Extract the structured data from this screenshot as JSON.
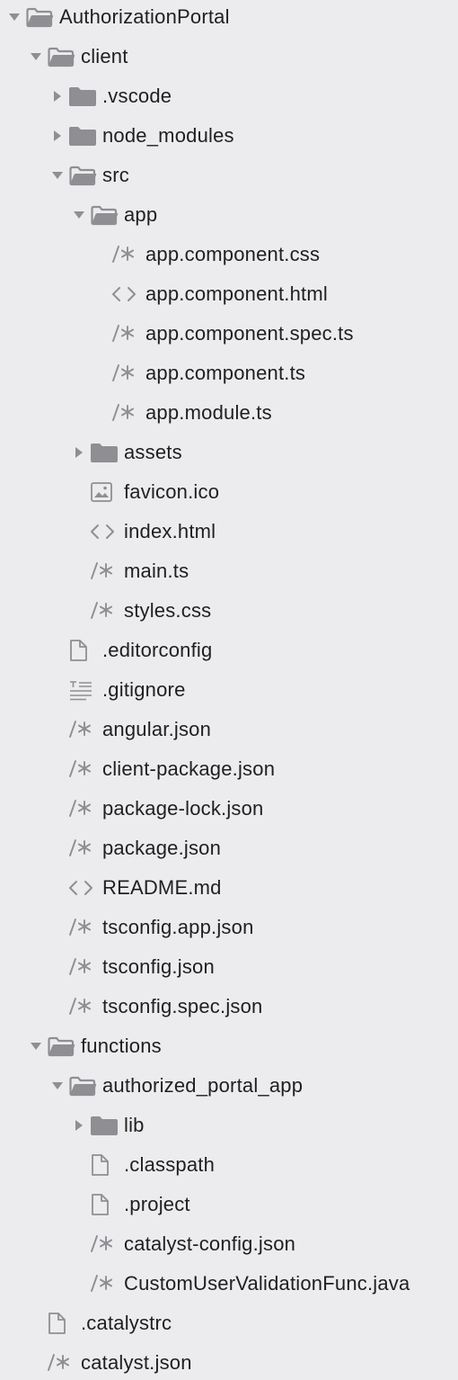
{
  "tree": [
    {
      "label": "AuthorizationPortal",
      "level": 0,
      "type": "folder",
      "state": "expanded",
      "icon": "folder-open-icon"
    },
    {
      "label": "client",
      "level": 1,
      "type": "folder",
      "state": "expanded",
      "icon": "folder-open-icon"
    },
    {
      "label": ".vscode",
      "level": 2,
      "type": "folder",
      "state": "collapsed",
      "icon": "folder-icon"
    },
    {
      "label": "node_modules",
      "level": 2,
      "type": "folder",
      "state": "collapsed",
      "icon": "folder-icon"
    },
    {
      "label": "src",
      "level": 2,
      "type": "folder",
      "state": "expanded",
      "icon": "folder-open-icon"
    },
    {
      "label": "app",
      "level": 3,
      "type": "folder",
      "state": "expanded",
      "icon": "folder-open-icon"
    },
    {
      "label": "app.component.css",
      "level": 4,
      "type": "file",
      "icon": "comment-code-icon"
    },
    {
      "label": "app.component.html",
      "level": 4,
      "type": "file",
      "icon": "angle-brackets-icon"
    },
    {
      "label": "app.component.spec.ts",
      "level": 4,
      "type": "file",
      "icon": "comment-code-icon"
    },
    {
      "label": "app.component.ts",
      "level": 4,
      "type": "file",
      "icon": "comment-code-icon"
    },
    {
      "label": "app.module.ts",
      "level": 4,
      "type": "file",
      "icon": "comment-code-icon"
    },
    {
      "label": "assets",
      "level": 3,
      "type": "folder",
      "state": "collapsed",
      "icon": "folder-icon"
    },
    {
      "label": "favicon.ico",
      "level": 3,
      "type": "file",
      "icon": "image-icon"
    },
    {
      "label": "index.html",
      "level": 3,
      "type": "file",
      "icon": "angle-brackets-icon"
    },
    {
      "label": "main.ts",
      "level": 3,
      "type": "file",
      "icon": "comment-code-icon"
    },
    {
      "label": "styles.css",
      "level": 3,
      "type": "file",
      "icon": "comment-code-icon"
    },
    {
      "label": ".editorconfig",
      "level": 2,
      "type": "file",
      "icon": "document-icon"
    },
    {
      "label": ".gitignore",
      "level": 2,
      "type": "file",
      "icon": "text-lines-icon"
    },
    {
      "label": "angular.json",
      "level": 2,
      "type": "file",
      "icon": "comment-code-icon"
    },
    {
      "label": "client-package.json",
      "level": 2,
      "type": "file",
      "icon": "comment-code-icon"
    },
    {
      "label": "package-lock.json",
      "level": 2,
      "type": "file",
      "icon": "comment-code-icon"
    },
    {
      "label": "package.json",
      "level": 2,
      "type": "file",
      "icon": "comment-code-icon"
    },
    {
      "label": "README.md",
      "level": 2,
      "type": "file",
      "icon": "angle-brackets-icon"
    },
    {
      "label": "tsconfig.app.json",
      "level": 2,
      "type": "file",
      "icon": "comment-code-icon"
    },
    {
      "label": "tsconfig.json",
      "level": 2,
      "type": "file",
      "icon": "comment-code-icon"
    },
    {
      "label": "tsconfig.spec.json",
      "level": 2,
      "type": "file",
      "icon": "comment-code-icon"
    },
    {
      "label": "functions",
      "level": 1,
      "type": "folder",
      "state": "expanded",
      "icon": "folder-open-icon"
    },
    {
      "label": "authorized_portal_app",
      "level": 2,
      "type": "folder",
      "state": "expanded",
      "icon": "folder-open-icon"
    },
    {
      "label": "lib",
      "level": 3,
      "type": "folder",
      "state": "collapsed",
      "icon": "folder-icon"
    },
    {
      "label": ".classpath",
      "level": 3,
      "type": "file",
      "icon": "document-icon"
    },
    {
      "label": ".project",
      "level": 3,
      "type": "file",
      "icon": "document-icon"
    },
    {
      "label": "catalyst-config.json",
      "level": 3,
      "type": "file",
      "icon": "comment-code-icon"
    },
    {
      "label": "CustomUserValidationFunc.java",
      "level": 3,
      "type": "file",
      "icon": "comment-code-icon"
    },
    {
      "label": ".catalystrc",
      "level": 1,
      "type": "file",
      "icon": "document-icon"
    },
    {
      "label": "catalyst.json",
      "level": 1,
      "type": "file",
      "icon": "comment-code-icon"
    }
  ],
  "colors": {
    "background": "#ececee",
    "icon": "#8e8e93",
    "arrow": "#8e8e93",
    "text": "#1f1f1f"
  }
}
